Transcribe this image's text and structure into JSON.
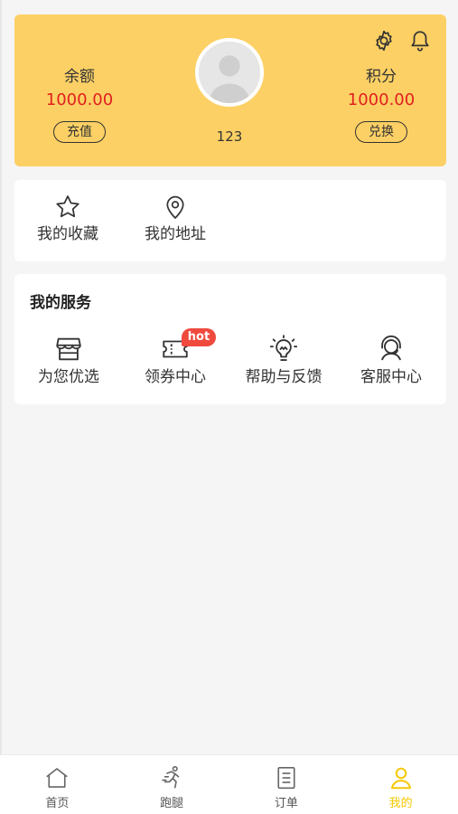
{
  "header": {
    "balance_label": "余额",
    "balance_value": "1000.00",
    "recharge_label": "充值",
    "points_label": "积分",
    "points_value": "1000.00",
    "exchange_label": "兑换",
    "username": "123"
  },
  "quick": {
    "items": [
      {
        "label": "我的收藏",
        "icon": "star-icon"
      },
      {
        "label": "我的地址",
        "icon": "location-pin-icon"
      }
    ]
  },
  "services": {
    "title": "我的服务",
    "badge": "hot",
    "items": [
      {
        "label": "为您优选",
        "icon": "store-icon"
      },
      {
        "label": "领券中心",
        "icon": "ticket-icon"
      },
      {
        "label": "帮助与反馈",
        "icon": "lightbulb-icon"
      },
      {
        "label": "客服中心",
        "icon": "customer-service-icon"
      }
    ]
  },
  "tabbar": {
    "items": [
      {
        "label": "首页",
        "icon": "home-icon"
      },
      {
        "label": "跑腿",
        "icon": "runner-icon"
      },
      {
        "label": "订单",
        "icon": "order-list-icon"
      },
      {
        "label": "我的",
        "icon": "user-icon",
        "active": true
      }
    ]
  },
  "colors": {
    "header_bg": "#fcd064",
    "value_red": "#e02020",
    "badge_red": "#f04a3e",
    "active_tab": "#f6c800"
  }
}
